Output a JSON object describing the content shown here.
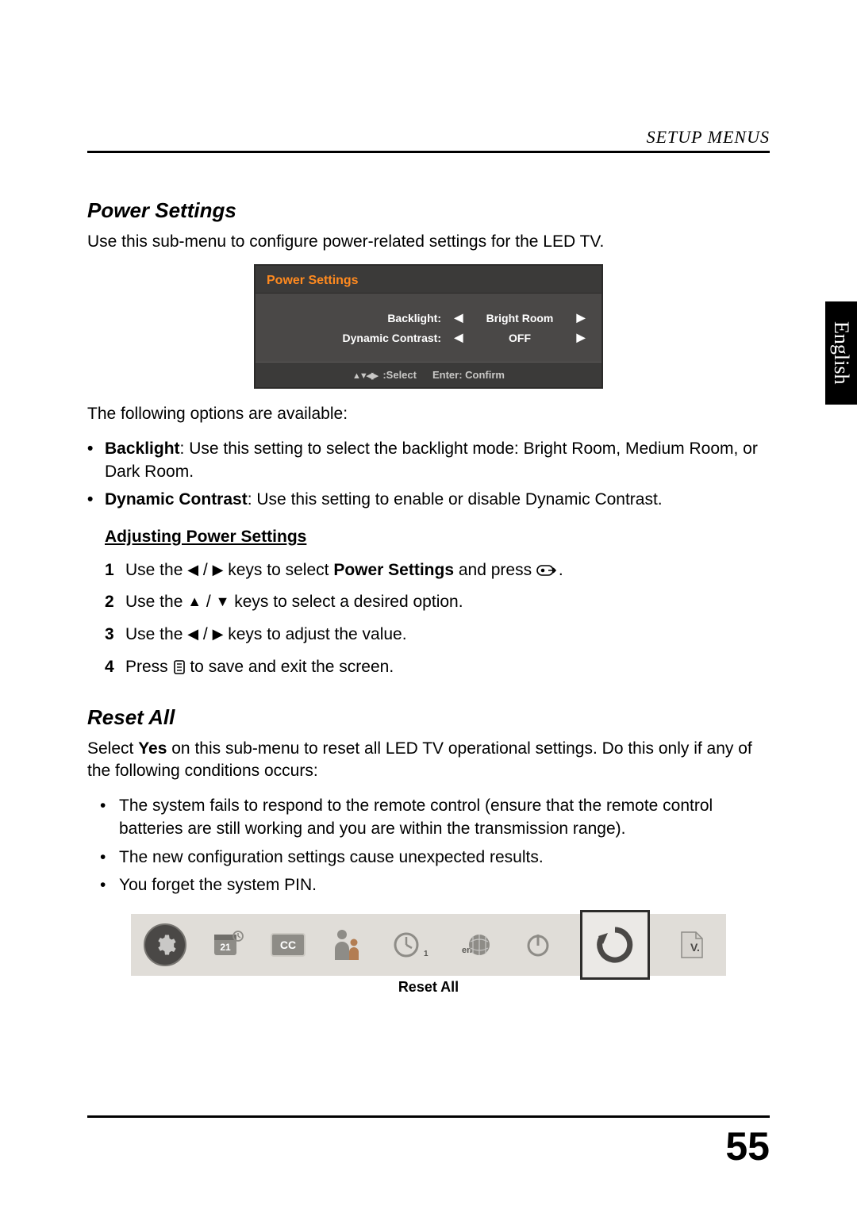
{
  "header": {
    "section_title": "SETUP MENUS"
  },
  "lang_tab": "English",
  "power_settings": {
    "heading": "Power Settings",
    "intro": "Use this sub-menu to configure power-related settings for the LED TV.",
    "osd": {
      "title": "Power Settings",
      "rows": [
        {
          "label": "Backlight:",
          "value": "Bright Room"
        },
        {
          "label": "Dynamic Contrast:",
          "value": "OFF"
        }
      ],
      "footer_select": ":Select",
      "footer_confirm": "Enter: Confirm"
    },
    "options_intro": "The following options are available:",
    "options": [
      {
        "term": "Backlight",
        "desc": ": Use this setting to select the backlight mode: Bright Room, Medium Room, or Dark Room."
      },
      {
        "term": "Dynamic Contrast",
        "desc": ": Use this setting to enable or disable Dynamic Contrast."
      }
    ],
    "adjust_heading": "Adjusting Power Settings",
    "steps": {
      "s1a": "Use the ",
      "s1b": " keys to select ",
      "s1c": "Power Settings",
      "s1d": " and press ",
      "s1e": ".",
      "s2a": "Use the ",
      "s2b": " keys to select a desired option.",
      "s3a": "Use the ",
      "s3b": " keys to adjust the value.",
      "s4a": "Press ",
      "s4b": " to save and exit the screen."
    }
  },
  "reset_all": {
    "heading": "Reset All",
    "intro_a": "Select ",
    "intro_b": "Yes",
    "intro_c": " on this sub-menu to reset all LED TV operational settings. Do this only if any of the following conditions occurs:",
    "bullets": [
      "The system fails to respond to the remote control (ensure that the remote control batteries are still working and you are within the transmission range).",
      "The new configuration settings cause unexpected results.",
      "You forget the system PIN."
    ],
    "strip": {
      "tiles": {
        "gear": "settings-icon",
        "t_cal": "21",
        "t_cc": "CC",
        "t_parental": "parental",
        "t_timer": "10s",
        "t_lang": "en",
        "t_power": "power",
        "t_reset": "reset",
        "t_ver": "V."
      },
      "caption": "Reset All"
    }
  },
  "page_number": "55"
}
